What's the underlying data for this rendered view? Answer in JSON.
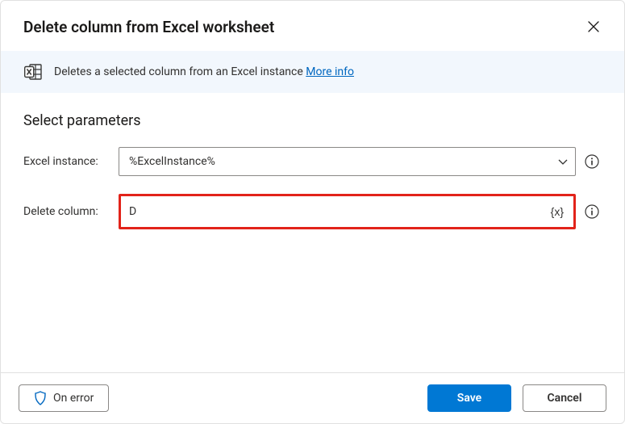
{
  "header": {
    "title": "Delete column from Excel worksheet"
  },
  "infobar": {
    "description": "Deletes a selected column from an Excel instance ",
    "more_info_label": "More info"
  },
  "body": {
    "section_title": "Select parameters",
    "excel_instance": {
      "label": "Excel instance:",
      "value": "%ExcelInstance%"
    },
    "delete_column": {
      "label": "Delete column:",
      "value": "D",
      "var_token": "{x}"
    }
  },
  "footer": {
    "on_error_label": "On error",
    "save_label": "Save",
    "cancel_label": "Cancel"
  }
}
